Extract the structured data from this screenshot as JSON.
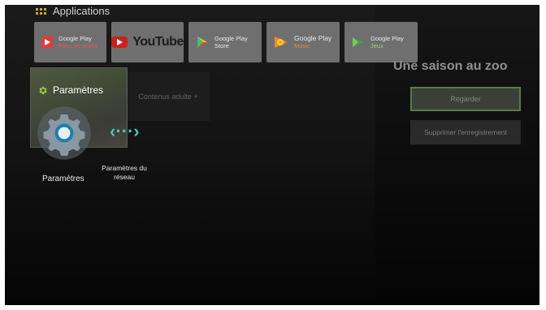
{
  "apps_section": {
    "title": "Applications",
    "icon": "grid-icon"
  },
  "apps": [
    {
      "name": "Google Play",
      "sub": "Films et séries",
      "icon": "play-movies-icon"
    },
    {
      "name": "YouTube",
      "icon": "youtube-icon"
    },
    {
      "name": "Google Play",
      "sub": "Store",
      "icon": "play-store-icon"
    },
    {
      "name": "Google Play",
      "sub": "Music",
      "icon": "play-music-icon"
    },
    {
      "name": "Google Play",
      "sub": "Jeux",
      "icon": "play-games-icon"
    }
  ],
  "adult_card": {
    "label": "Contenus adulte +"
  },
  "settings_card": {
    "title": "Paramètres",
    "icon": "gear-icon"
  },
  "settings_shortcuts": [
    {
      "label": "Paramètres",
      "icon": "gear-icon"
    },
    {
      "label": "Paramètres du réseau",
      "icon": "network-arrows-icon"
    }
  ],
  "detail": {
    "title": "Une saison au zoo",
    "watch_button": "Regarder",
    "delete_button": "Supprimer l'enregistrement"
  },
  "colors": {
    "accent_green": "#5a7a48",
    "network_teal": "#54c2b4",
    "youtube_red": "#c8221d"
  }
}
